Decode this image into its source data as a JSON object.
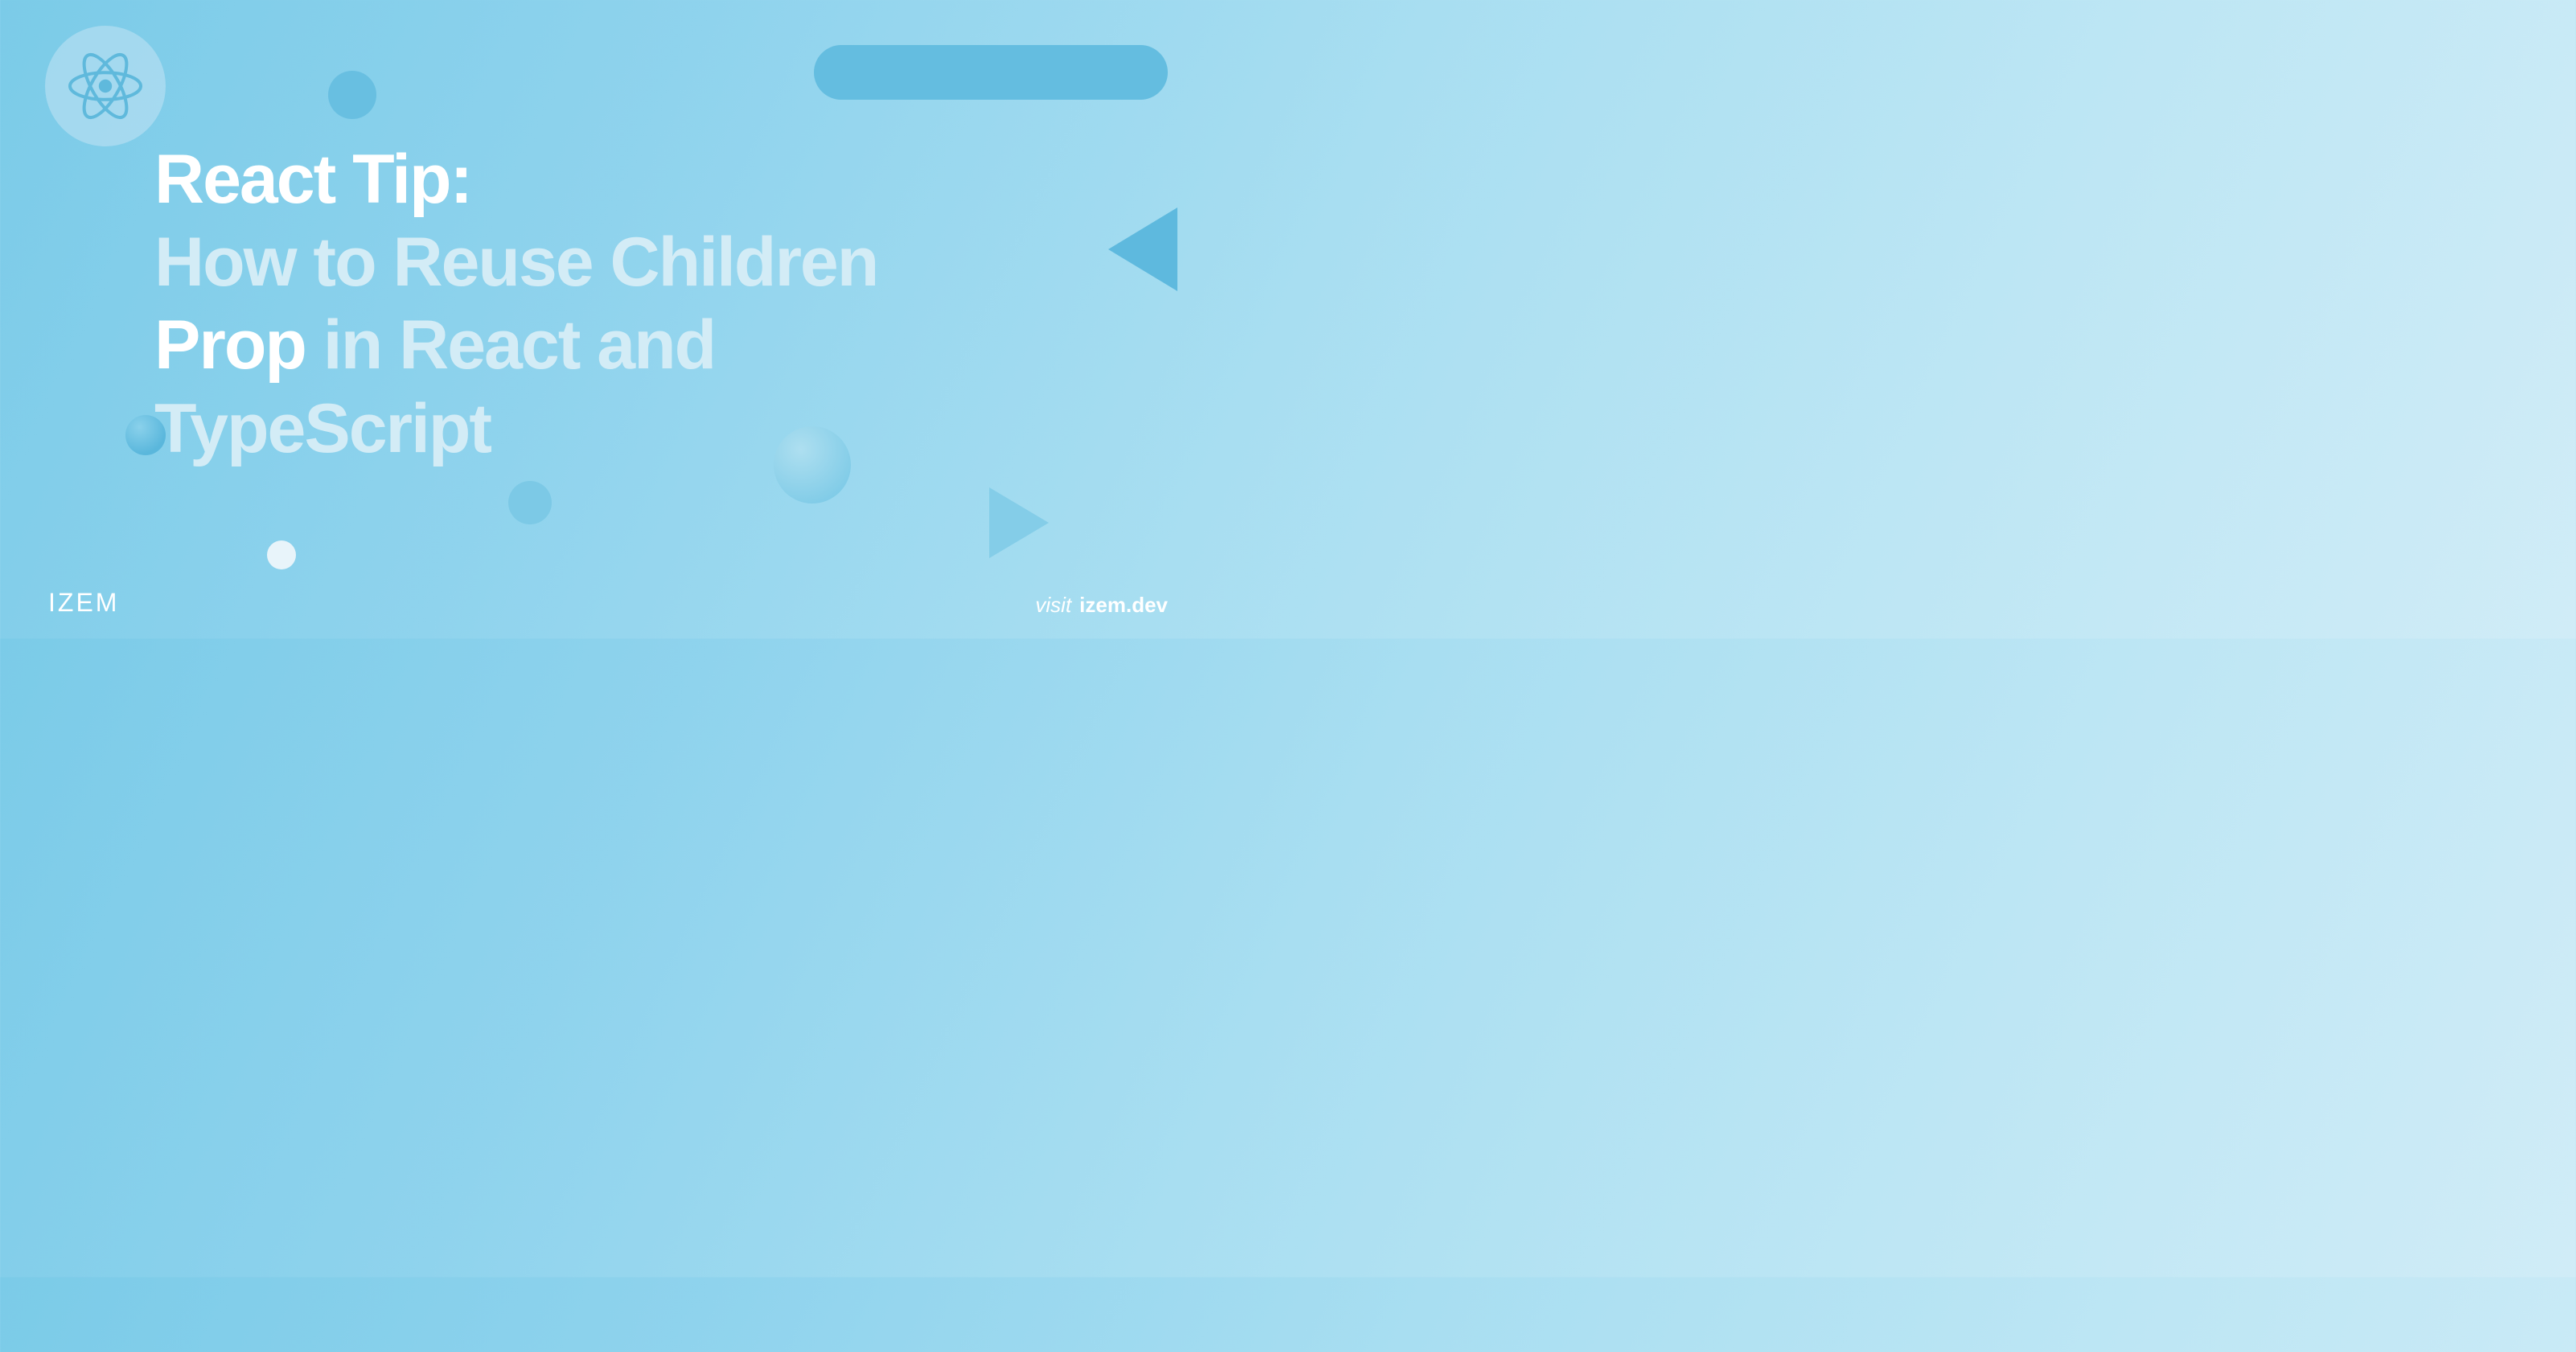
{
  "badge": {
    "icon_name": "react-logo"
  },
  "title": {
    "line1_white": "React Tip:",
    "line2_light": "How to Reuse Children",
    "line3_white": "Prop",
    "line3_light": " in React and",
    "line4_light": "TypeScript"
  },
  "footer": {
    "logo": "IZEM",
    "visit_label": "visit",
    "domain": "izem.dev"
  }
}
